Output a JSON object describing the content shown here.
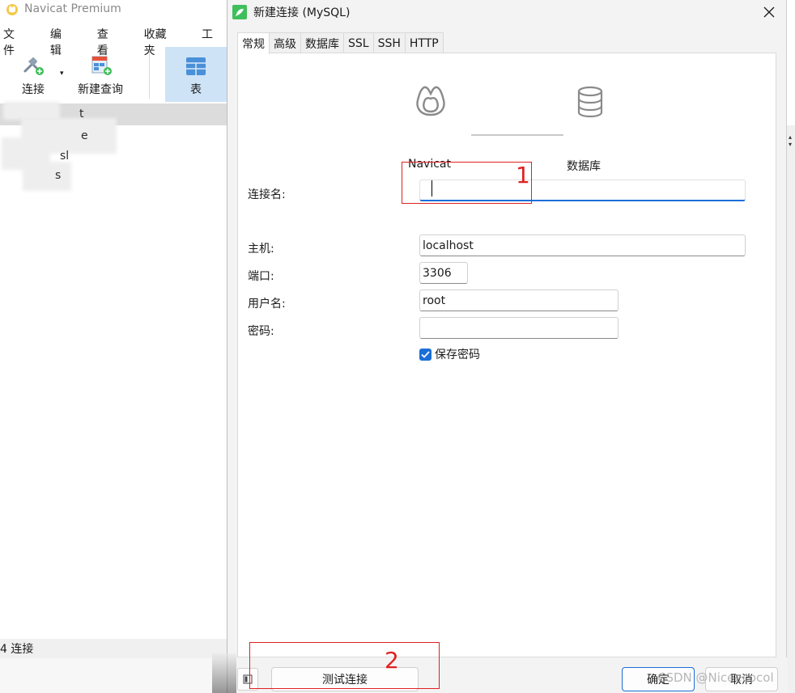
{
  "main_window": {
    "title": "Navicat Premium",
    "menu": [
      "文件",
      "编辑",
      "查看",
      "收藏夹",
      "工"
    ],
    "toolbar": {
      "connect_label": "连接",
      "new_query_label": "新建查询",
      "table_label": "表"
    },
    "nav_fragments": [
      "t",
      "e",
      "sl",
      "s"
    ],
    "status": "4 连接"
  },
  "dialog": {
    "title": "新建连接 (MySQL)",
    "tabs": [
      "常规",
      "高级",
      "数据库",
      "SSL",
      "SSH",
      "HTTP"
    ],
    "active_tab": 0,
    "diagram": {
      "left_label": "Navicat",
      "right_label": "数据库"
    },
    "form": {
      "connection_name_label": "连接名:",
      "connection_name_value": "",
      "host_label": "主机:",
      "host_value": "localhost",
      "port_label": "端口:",
      "port_value": "3306",
      "username_label": "用户名:",
      "username_value": "root",
      "password_label": "密码:",
      "password_value": "",
      "save_password_label": "保存密码",
      "save_password_checked": true
    },
    "buttons": {
      "test_connection": "测试连接",
      "ok": "确定",
      "cancel": "取消"
    }
  },
  "annotations": {
    "marker_1": "1",
    "marker_2": "2"
  },
  "watermark": "CSDN @Niceecocol",
  "colors": {
    "accent": "#1a6ed8",
    "annotation": "#e02020",
    "navicat_green": "#3fbf5a"
  }
}
